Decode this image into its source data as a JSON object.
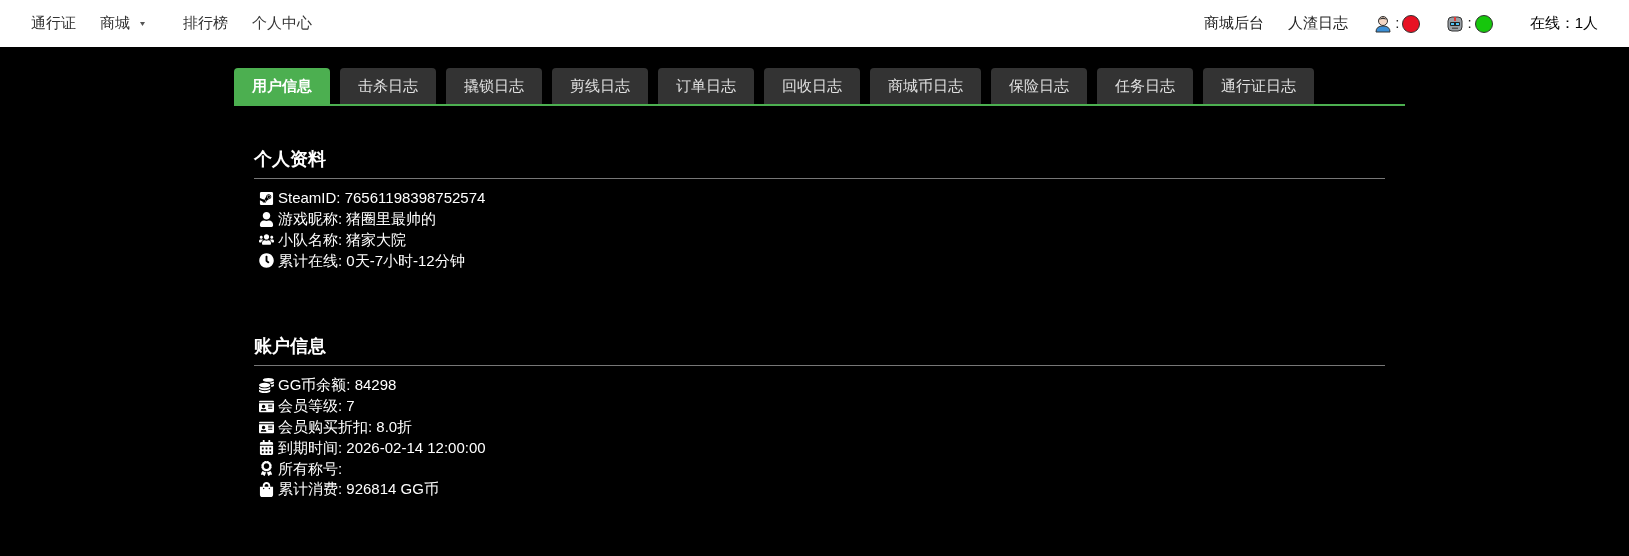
{
  "nav": {
    "left": [
      {
        "label": "通行证",
        "dropdown": false
      },
      {
        "label": "商城",
        "dropdown": true
      },
      {
        "label": "排行榜",
        "dropdown": false
      },
      {
        "label": "个人中心",
        "dropdown": false
      }
    ],
    "right": [
      "商城后台",
      "人渣日志"
    ],
    "status": [
      {
        "kind": "person",
        "separator": ":",
        "color": "#e81123"
      },
      {
        "kind": "robot",
        "separator": ":",
        "color": "#16c60c"
      }
    ],
    "online": "在线：1人"
  },
  "tabs": [
    {
      "label": "用户信息",
      "selected": true
    },
    {
      "label": "击杀日志",
      "selected": false
    },
    {
      "label": "撬锁日志",
      "selected": false
    },
    {
      "label": "剪线日志",
      "selected": false
    },
    {
      "label": "订单日志",
      "selected": false
    },
    {
      "label": "回收日志",
      "selected": false
    },
    {
      "label": "商城币日志",
      "selected": false
    },
    {
      "label": "保险日志",
      "selected": false
    },
    {
      "label": "任务日志",
      "selected": false
    },
    {
      "label": "通行证日志",
      "selected": false
    }
  ],
  "sections": [
    {
      "title": "个人资料",
      "rows": [
        {
          "kind": "steam",
          "text": "SteamID: 76561198398752574"
        },
        {
          "kind": "user",
          "text": "游戏昵称: 猪圈里最帅的"
        },
        {
          "kind": "users",
          "text": "小队名称: 猪家大院"
        },
        {
          "kind": "clock",
          "text": "累计在线: 0天-7小时-12分钟"
        }
      ]
    },
    {
      "title": "账户信息",
      "rows": [
        {
          "kind": "coins",
          "text": "GG币余额: 84298"
        },
        {
          "kind": "card",
          "text": "会员等级: 7"
        },
        {
          "kind": "card",
          "text": "会员购买折扣: 8.0折"
        },
        {
          "kind": "calendar",
          "text": "到期时间: 2026-02-14 12:00:00"
        },
        {
          "kind": "award",
          "text": "所有称号:"
        },
        {
          "kind": "bag",
          "text": "累计消费: 926814 GG币"
        }
      ]
    }
  ]
}
